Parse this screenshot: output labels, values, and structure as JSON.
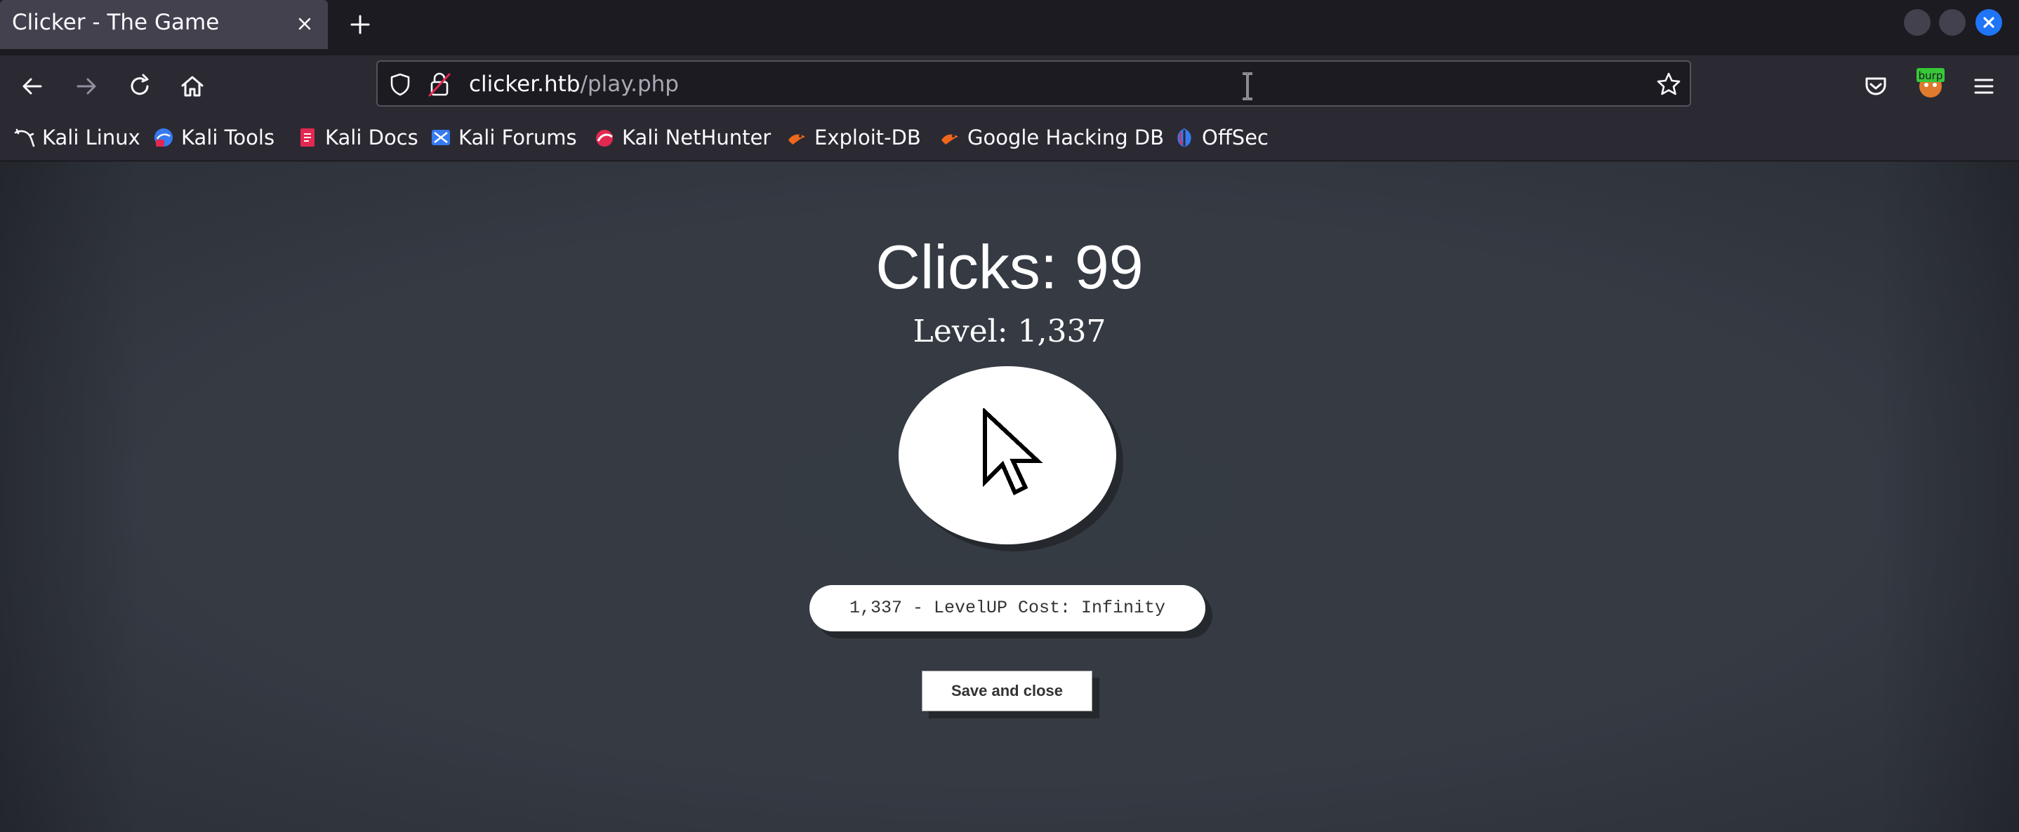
{
  "browser": {
    "tab_title": "Clicker - The Game",
    "url_domain": "clicker.htb",
    "url_path": "/play.php",
    "icons": [
      "close-icon",
      "plus-icon",
      "back-arrow-icon",
      "forward-arrow-icon",
      "reload-icon",
      "home-icon",
      "shield-icon",
      "lock-icon",
      "star-icon",
      "pocket-icon",
      "burp-extension-icon",
      "hamburger-menu-icon"
    ],
    "bookmarks": [
      {
        "label": "Kali Linux",
        "icon": "kali-dragon-icon"
      },
      {
        "label": "Kali Tools",
        "icon": "kali-tools-icon"
      },
      {
        "label": "Kali Docs",
        "icon": "kali-docs-icon"
      },
      {
        "label": "Kali Forums",
        "icon": "kali-forums-icon"
      },
      {
        "label": "Kali NetHunter",
        "icon": "nethunter-icon"
      },
      {
        "label": "Exploit-DB",
        "icon": "exploit-db-icon"
      },
      {
        "label": "Google Hacking DB",
        "icon": "ghdb-icon"
      },
      {
        "label": "OffSec",
        "icon": "offsec-icon"
      }
    ]
  },
  "game": {
    "clicks_text": "Clicks: 99",
    "level_text": "Level: 1,337",
    "levelup_text": "1,337 - LevelUP Cost: Infinity",
    "save_label": "Save and close",
    "clicker_icon": "mouse-cursor-icon"
  },
  "colors": {
    "tab_bg": "#42414d",
    "toolbar_bg": "#2b2a33",
    "page_bg": "#353a43",
    "close_button": "#1f75f5"
  }
}
